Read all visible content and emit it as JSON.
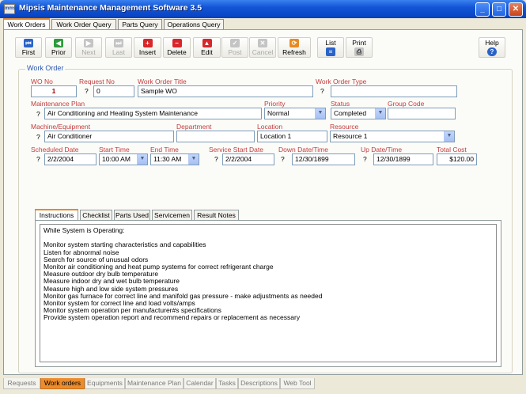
{
  "window": {
    "app_icon": "mms",
    "title": "Mipsis Maintenance Management Software 3.5",
    "min_glyph": "_",
    "max_glyph": "□",
    "close_glyph": "✕"
  },
  "top_tabs": [
    "Work Orders",
    "Work Order Query",
    "Parts Query",
    "Operations Query"
  ],
  "toolbar": {
    "first": "First",
    "prior": "Prior",
    "next": "Next",
    "last": "Last",
    "insert": "Insert",
    "delete": "Delete",
    "edit": "Edit",
    "post": "Post",
    "cancel": "Cancel",
    "refresh": "Refresh",
    "list": "List",
    "print": "Print",
    "help": "Help"
  },
  "work_order": {
    "legend": "Work Order",
    "labels": {
      "wo_no": "WO No",
      "request_no": "Request No",
      "title": "Work Order Title",
      "type": "Work Order Type",
      "plan": "Maintenance Plan",
      "priority": "Priority",
      "status": "Status",
      "group_code": "Group Code",
      "machine": "Machine/Equipment",
      "department": "Department",
      "location": "Location",
      "resource": "Resource",
      "scheduled_date": "Scheduled Date",
      "start_time": "Start Time",
      "end_time": "End Time",
      "service_start": "Service Start Date",
      "down_date": "Down Date/Time",
      "up_date": "Up Date/Time",
      "total_cost": "Total Cost"
    },
    "q": "?",
    "values": {
      "wo_no": "1",
      "request_no": "0",
      "title": "Sample WO",
      "type": "",
      "plan": "Air Conditioning and Heating System Maintenance",
      "priority": "Normal",
      "status": "Completed",
      "group_code": "",
      "machine": "Air Conditioner",
      "department": "",
      "location": "Location 1",
      "resource": "Resource 1",
      "scheduled_date": "2/2/2004",
      "start_time": "10:00 AM",
      "end_time": "11:30 AM",
      "service_start": "2/2/2004",
      "down_date": "12/30/1899",
      "up_date": "12/30/1899",
      "total_cost": "$120.00"
    }
  },
  "inner_tabs": [
    "Instructions",
    "Checklist",
    "Parts Used",
    "Servicemen",
    "Result Notes"
  ],
  "instructions": [
    "While System is Operating:",
    "",
    "Monitor system starting characteristics and capabilities",
    "Listen for abnormal noise",
    "Search for source of unusual odors",
    "Monitor air conditioning and heat pump systems for correct refrigerant charge",
    "Measure outdoor dry bulb temperature",
    "Measure indoor dry and wet bulb temperature",
    "Measure high and low side system pressures",
    "Monitor gas furnace for correct line and manifold gas pressure - make adjustments as needed",
    "Monitor system for correct line and load volts/amps",
    "Monitor system operation per manufacturer#s specifications",
    "Provide system operation report and recommend repairs or replacement as necessary"
  ],
  "bottom_tabs": [
    "Requests",
    "Work orders",
    "Equipments",
    "Maintenance Plan",
    "Calendar",
    "Tasks",
    "Descriptions",
    "Web Tool"
  ],
  "icons": {
    "first": "⏮",
    "prior": "◀",
    "next": "▶",
    "last": "⏭",
    "insert": "+",
    "delete": "−",
    "edit": "▲",
    "post": "✓",
    "cancel": "✕",
    "refresh": "⟳",
    "list": "≡",
    "print": "⎙",
    "help": "?",
    "combo": "▼"
  }
}
